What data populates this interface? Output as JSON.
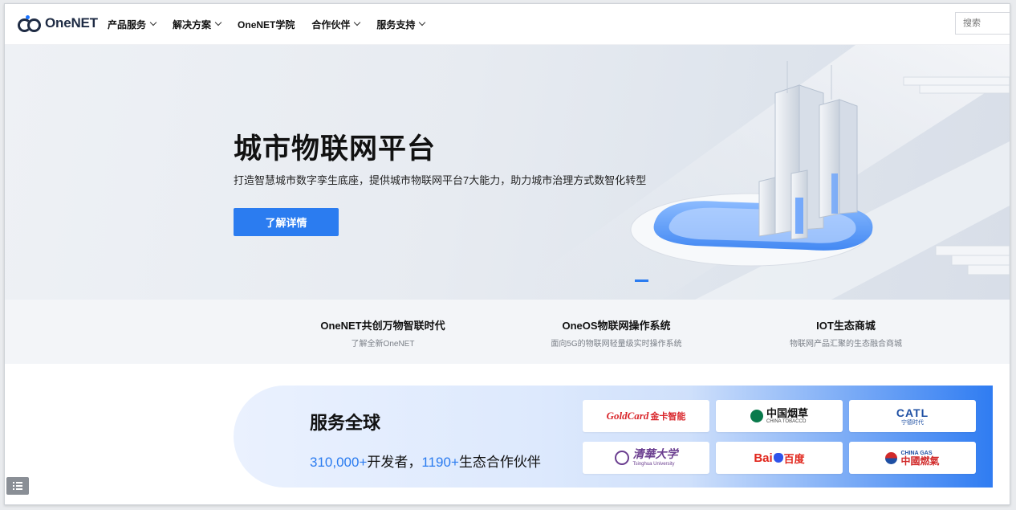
{
  "header": {
    "logo_text": "OneNET",
    "nav": [
      {
        "label": "产品服务",
        "dropdown": true
      },
      {
        "label": "解决方案",
        "dropdown": true
      },
      {
        "label": "OneNET学院",
        "dropdown": false
      },
      {
        "label": "合作伙伴",
        "dropdown": true
      },
      {
        "label": "服务支持",
        "dropdown": true
      }
    ],
    "search_placeholder": "搜索"
  },
  "hero": {
    "title": "城市物联网平台",
    "subtitle": "打造智慧城市数字孪生底座，提供城市物联网平台7大能力，助力城市治理方式数智化转型",
    "button_label": "了解详情"
  },
  "features": [
    {
      "title": "OneNET共创万物智联时代",
      "desc": "了解全新OneNET"
    },
    {
      "title": "OneOS物联网操作系统",
      "desc": "面向5G的物联网轻量级实时操作系统"
    },
    {
      "title": "IOT生态商城",
      "desc": "物联网产品汇聚的生态融合商城"
    }
  ],
  "banner": {
    "title": "服务全球",
    "developers_num": "310,000+",
    "developers_label": "开发者，",
    "partners_num": "1190+",
    "partners_label": "生态合作伙伴"
  },
  "partners": [
    {
      "name": "GoldCard 金卡智能",
      "line1": "GoldCard",
      "line2": "金卡智能",
      "color": "#d9262b"
    },
    {
      "name": "中国烟草",
      "line1": "中国烟草",
      "line2": "CHINA TOBACCO",
      "color": "#0a7a4c"
    },
    {
      "name": "CATL 宁德时代",
      "line1": "CATL",
      "line2": "宁德时代",
      "color": "#1e4fa3"
    },
    {
      "name": "清华大学",
      "line1": "清華大学",
      "line2": "Tsinghua University",
      "color": "#6a3d8f"
    },
    {
      "name": "Baidu 百度",
      "line1": "Bai",
      "line2": "百度",
      "color": "#2f54eb"
    },
    {
      "name": "中国燃气 CHINA GAS",
      "line1": "CHINA GAS",
      "line2": "中國燃氣",
      "color": "#d12a2a"
    }
  ],
  "colors": {
    "accent": "#2b7cf0",
    "text": "#111111"
  }
}
